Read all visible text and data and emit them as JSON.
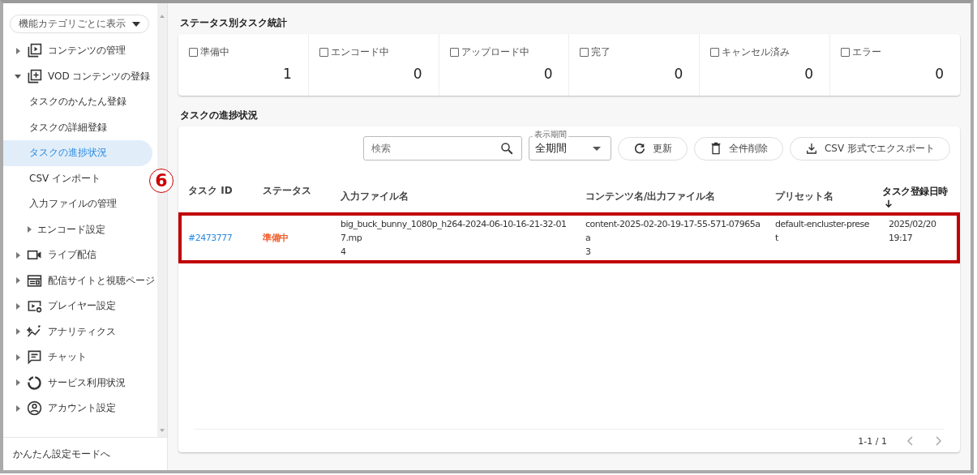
{
  "sidebar": {
    "view_selector": "機能カテゴリごとに表示",
    "items": [
      {
        "label": "コンテンツの管理",
        "expanded": false
      },
      {
        "label": "VOD コンテンツの登録",
        "expanded": true,
        "children": [
          {
            "label": "タスクのかんたん登録",
            "selected": false
          },
          {
            "label": "タスクの詳細登録",
            "selected": false
          },
          {
            "label": "タスクの進捗状況",
            "selected": true
          },
          {
            "label": "CSV インポート",
            "selected": false
          },
          {
            "label": "入力ファイルの管理",
            "selected": false
          },
          {
            "label": "エンコード設定",
            "expanded": false,
            "selected": false
          }
        ]
      },
      {
        "label": "ライブ配信",
        "expanded": false
      },
      {
        "label": "配信サイトと視聴ページ",
        "expanded": false
      },
      {
        "label": "プレイヤー設定",
        "expanded": false
      },
      {
        "label": "アナリティクス",
        "expanded": false
      },
      {
        "label": "チャット",
        "expanded": false
      },
      {
        "label": "サービス利用状況",
        "expanded": false
      },
      {
        "label": "アカウント設定",
        "expanded": false
      }
    ],
    "footer_link": "かんたん設定モードへ"
  },
  "stats": {
    "title": "ステータス別タスク統計",
    "cards": [
      {
        "label": "準備中",
        "checked": false,
        "count": "1"
      },
      {
        "label": "エンコード中",
        "checked": false,
        "count": "0"
      },
      {
        "label": "アップロード中",
        "checked": false,
        "count": "0"
      },
      {
        "label": "完了",
        "checked": false,
        "count": "0"
      },
      {
        "label": "キャンセル済み",
        "checked": false,
        "count": "0"
      },
      {
        "label": "エラー",
        "checked": false,
        "count": "0"
      }
    ]
  },
  "progress": {
    "title": "タスクの進捗状況",
    "search": {
      "placeholder": "検索"
    },
    "period": {
      "label": "表示期間",
      "value": "全期間"
    },
    "buttons": [
      "更新",
      "全件削除",
      "CSV 形式でエクスポート"
    ],
    "annotation": "6",
    "table": {
      "columns": [
        {
          "label": "タスク ID",
          "sorted": false
        },
        {
          "label": "ステータス",
          "sorted": false
        },
        {
          "label": "入力ファイル名",
          "sorted": false
        },
        {
          "label": "コンテンツ名/出力ファイル名",
          "sorted": false
        },
        {
          "label": "プリセット名",
          "sorted": false
        },
        {
          "label": "タスク登録日時",
          "sorted": true
        }
      ],
      "rows": [
        {
          "highlighted": true,
          "cells": [
            "#2473777",
            "準備中",
            "big_buck_bunny_1080p_h264-2024-06-10-16-21-32-017.mp\n4",
            "content-2025-02-20-19-17-55-571-07965aa\n3",
            "default-encluster-prese\nt",
            "2025/02/20\n19:17"
          ]
        }
      ]
    },
    "pagination": "1-1 / 1"
  }
}
